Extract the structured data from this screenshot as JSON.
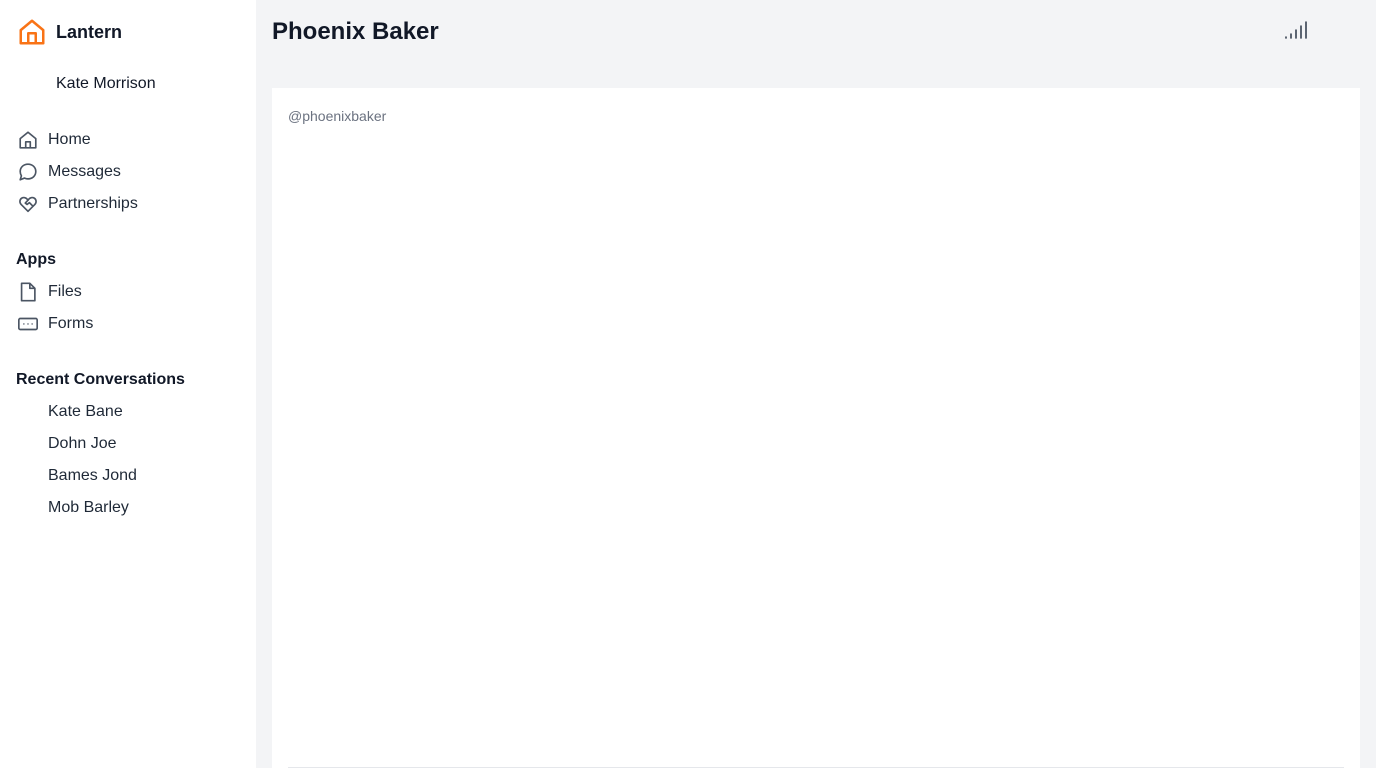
{
  "brand": {
    "name": "Lantern",
    "logo_icon": "home-outline-icon",
    "accent": "#f97316"
  },
  "user": {
    "name": "Kate Morrison"
  },
  "nav": {
    "items": [
      {
        "label": "Home",
        "icon": "home-icon"
      },
      {
        "label": "Messages",
        "icon": "chat-bubble-icon"
      },
      {
        "label": "Partnerships",
        "icon": "heart-handshake-icon"
      }
    ]
  },
  "apps": {
    "title": "Apps",
    "items": [
      {
        "label": "Files",
        "icon": "file-icon"
      },
      {
        "label": "Forms",
        "icon": "form-input-icon"
      }
    ]
  },
  "recent": {
    "title": "Recent Conversations",
    "items": [
      {
        "label": "Kate Bane"
      },
      {
        "label": "Dohn Joe"
      },
      {
        "label": "Bames Jond"
      },
      {
        "label": "Mob Barley"
      }
    ]
  },
  "header": {
    "title": "Phoenix Baker",
    "action_icon": "signal-bars-icon"
  },
  "profile": {
    "handle": "@phoenixbaker"
  }
}
